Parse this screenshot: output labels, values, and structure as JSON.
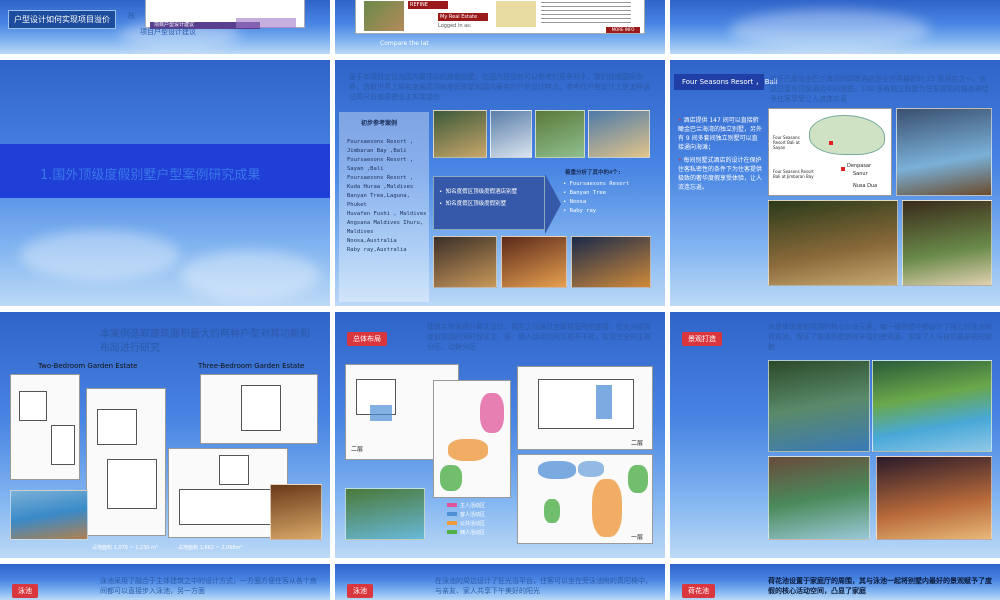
{
  "row1": {
    "s1_tag": "户型设计如何实现项目溢价",
    "s1_mid": "核",
    "s1_note": "项目户型设计建议",
    "s1_inner_label": "项目户型设计建议",
    "s2_caption": "Compare the lat",
    "s2_tools": "My Real Estate Tools",
    "s2_logged": "Logged in as:",
    "s2_refine": "REFINE SEARCH",
    "s2_more": "MORE INFO"
  },
  "s4": {
    "title": "1.国外顶级度假别墅户型案例研究成果"
  },
  "s5": {
    "intro": "基于本项目定位为国内最顶尖的度假别墅，在国内还没有可以参考的竞争对手，我们放眼国际世界，选取世界上知名度最高顶级度假别墅和国内豪宅的户型设计特点，参考在户型设计上是怎样通过高尺价值感使业主实现溢价",
    "ref_title": "初步参考案例",
    "refs": [
      "Foursaesons Resort , Jimbaran Bay ,Bali",
      "Foursaesons Resort , Sayan ,Bali",
      "Foursaesons Resort , Kuda Huraa ,Maldives",
      "Banyan Tree,Laguna, Phuket",
      "Huvafen Fushi , Maldives",
      "Angsana Maldives Ihuru, Maldives",
      "Noosa,Australia",
      "Raby ray,Australia"
    ],
    "bullets": [
      "知名度假区顶级度假酒店别墅",
      "知名度假区顶级度假别墅"
    ],
    "pick_title": "着重分析了其中的4个:",
    "picks": [
      "Foursaesons Resort",
      "Banyan Tree",
      "Noosa",
      "Raby ray"
    ]
  },
  "s6": {
    "header": "Four Seasons Resort ， Bali",
    "intro": "位于巴厘岛金巴兰海湾的四季酒店是全世界最好的 25 家酒店之一。也是巴厘岛顶级酒店中的翘楚。100 多栋独立别墅为住客提供的服务将给予住客享受让人流连忘返",
    "bullets": [
      "酒店提供 147 间可以直接俯瞰金巴兰海湾的独立别墅，另外有 9 间多套间独立别墅可以直接通向海滩；",
      "每间别墅式酒店的设计在保护住客私密性的条件下为住客提供极致的奢华度假享受体验，让人流连忘返。"
    ],
    "map_labels": [
      "Four Seasons Resort Bali at Sayan",
      "Four Seasons Resort Bali at Jimbaran Bay",
      "Denpasar",
      "Sanur",
      "Nusa Dua"
    ]
  },
  "s7": {
    "title": "本案例选取建筑面积最大的两种户型对其功能和布局进行研究",
    "label_a": "Two-Bedroom Garden Estate",
    "label_b": "Three-Bedroom Garden Estate",
    "area_a": "占地面积 1,076 ~ 1,230 m²",
    "area_b": "占地面积 1,662 ~ 2,068m²"
  },
  "s8": {
    "tag": "总体布局",
    "text": "建筑主体采用分离式设计，相互之间通过连廊或庭院相连接，在充分提高度假氛围的同时保证主、客、佣人活动空间互相不干扰，实现完全的主客分区、动静分区",
    "floor_a": "一层",
    "floor_b": "二层",
    "legend": [
      "主人活动区",
      "客人活动区",
      "公共活动区",
      "佣人活动区"
    ],
    "legend_colors": [
      "#e0559a",
      "#4f8fd6",
      "#f09a3e",
      "#4fb04a"
    ]
  },
  "s9": {
    "tag": "景观打造",
    "text": "水是体现度假氛围的核心价值元素，每一幢别墅中都设计了独立的泳池和荷花池，保证了整体别墅拥有丰富的景观面，实现了人与自然最亲密的接触"
  },
  "row4": {
    "a_tag": "泳池",
    "a_text": "泳池采用了融合于主体建筑之中的设计方式，一方面方便住客从各个房间都可以直接步入泳池，另一方面",
    "b_tag": "泳池",
    "b_text": "在泳池的周边设计了狂光浴平台，住客可以坐在旁泳池附的真阳椅中，与亲友、家人共享下午美好的阳光",
    "c_tag": "荷花池",
    "c_text": "荷花池设置于家庭厅的周围，其与泳池一起将别墅内最好的景观赋予了度假的核心活动空间，凸显了家庭"
  }
}
